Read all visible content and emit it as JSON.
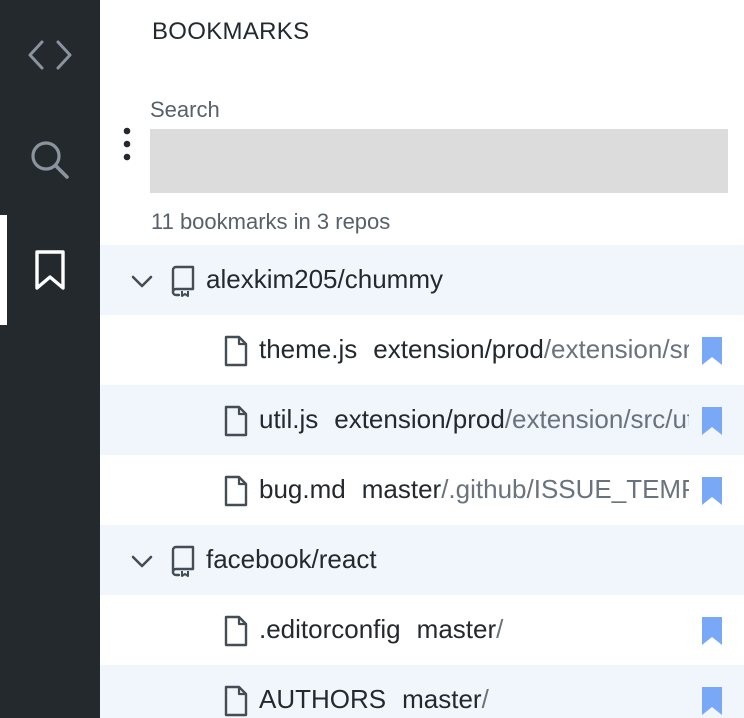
{
  "panel": {
    "title": "BOOKMARKS",
    "search_label": "Search",
    "search_value": "",
    "summary": "11 bookmarks in 3 repos"
  },
  "activity_bar": {
    "items": [
      {
        "icon": "code-icon"
      },
      {
        "icon": "search-icon"
      },
      {
        "icon": "bookmark-icon",
        "active": true
      }
    ]
  },
  "colors": {
    "activity_bg": "#24292e",
    "row_alt_bg": "#f1f5fc",
    "bookmark_fill": "#79a8f6",
    "search_bg": "#dcdcdc"
  },
  "repos": [
    {
      "name": "alexkim205/chummy",
      "files": [
        {
          "name": "theme.js",
          "branch": "extension/prod",
          "path": "/extension/src/theme.js"
        },
        {
          "name": "util.js",
          "branch": "extension/prod",
          "path": "/extension/src/util.js"
        },
        {
          "name": "bug.md",
          "branch": "master",
          "path": "/.github/ISSUE_TEMPLATE/bug.md"
        }
      ]
    },
    {
      "name": "facebook/react",
      "files": [
        {
          "name": ".editorconfig",
          "branch": "master",
          "path": "/"
        },
        {
          "name": "AUTHORS",
          "branch": "master",
          "path": "/"
        }
      ]
    }
  ]
}
